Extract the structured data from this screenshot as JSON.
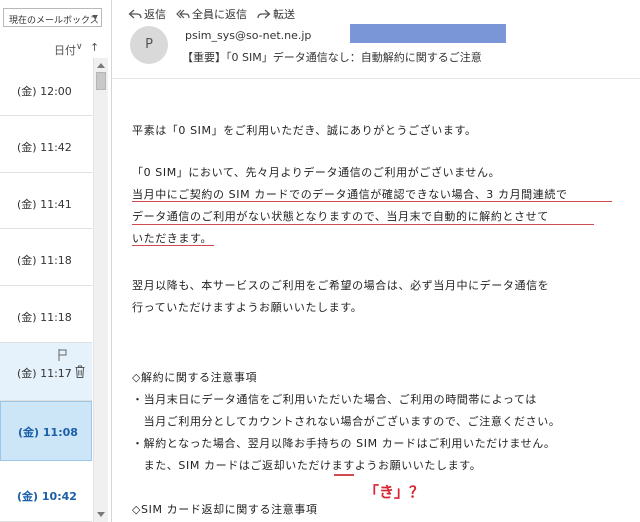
{
  "list": {
    "folder_label": "現在のメールボックス",
    "sort_label": "日付",
    "sort_chevron": "∨",
    "sort_arrow": "↑",
    "items": [
      {
        "time": "(金) 12:00"
      },
      {
        "time": "(金) 11:42"
      },
      {
        "time": "(金) 11:41"
      },
      {
        "time": "(金) 11:18"
      },
      {
        "time": "(金) 11:18"
      },
      {
        "time": "(金) 11:17"
      },
      {
        "time": "(金) 11:08"
      },
      {
        "time": "(金) 10:42"
      }
    ]
  },
  "header": {
    "actions": [
      "返信",
      "全員に返信",
      "転送"
    ],
    "avatar_initial": "P",
    "sender": "psim_sys@so-net.ne.jp",
    "subject": "【重要】「0 SIM」データ通信なし：自動解約に関するご注意"
  },
  "body": {
    "greeting": "平素は「0 SIM」をご利用いただき、誠にありがとうございます。",
    "p1": [
      "「0 SIM」において、先々月よりデータ通信のご利用がございません。",
      "当月中にご契約の SIM カードでのデータ通信が確認できない場合、3 カ月間連続で",
      "データ通信のご利用がない状態となりますので、当月末で自動的に解約とさせて",
      "いただきます。"
    ],
    "p2": [
      "翌月以降も、本サービスのご利用をご希望の場合は、必ず当月中にデータ通信を",
      "行っていただけますようお願いいたします。"
    ],
    "notice_title": "◇解約に関する注意事項",
    "notice_lines": [
      "・当月末日にデータ通信をご利用いただいた場合、ご利用の時間帯によっては",
      "　当月ご利用分としてカウントされない場合がございますので、ご注意ください。",
      "・解約となった場合、翌月以降お手持ちの SIM カードはご利用いただけません。",
      "　また、SIM カードはご返却いただけますようお願いいたします。"
    ],
    "annotation": "「き」？",
    "section2_title": "◇SIM カード返却に関する注意事項"
  }
}
